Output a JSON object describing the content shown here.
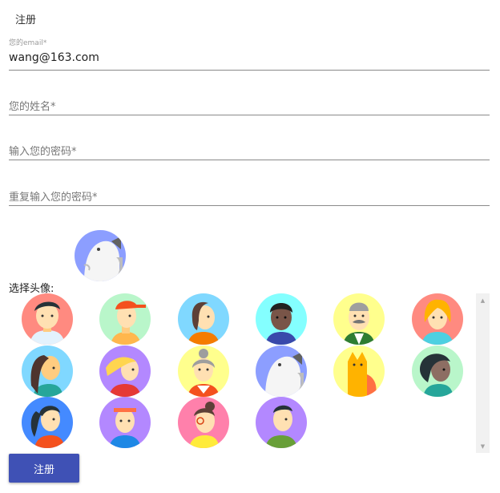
{
  "page": {
    "title": "注册"
  },
  "form": {
    "email": {
      "label": "您的email*",
      "value": "wang@163.com"
    },
    "name": {
      "placeholder": "您的姓名*"
    },
    "password": {
      "placeholder": "输入您的密码*"
    },
    "confirm_password": {
      "placeholder": "重复输入您的密码*"
    }
  },
  "selected_avatar": {
    "icon": "dog-avatar-icon",
    "bg": "#8c9eff"
  },
  "avatar_section": {
    "label": "选择头像:"
  },
  "avatars": [
    {
      "icon": "boy-dark-hair-avatar-icon",
      "bg": "#ff8a80"
    },
    {
      "icon": "boy-red-cap-avatar-icon",
      "bg": "#b9f6ca"
    },
    {
      "icon": "woman-brown-hair-avatar-icon",
      "bg": "#80d8ff"
    },
    {
      "icon": "dark-skin-man-avatar-icon",
      "bg": "#84ffff"
    },
    {
      "icon": "old-man-mustache-avatar-icon",
      "bg": "#ffff8d"
    },
    {
      "icon": "blonde-girl-avatar-icon",
      "bg": "#ff8a80"
    },
    {
      "icon": "long-hair-woman-avatar-icon",
      "bg": "#80d8ff"
    },
    {
      "icon": "blonde-woman-avatar-icon",
      "bg": "#b388ff"
    },
    {
      "icon": "grandma-avatar-icon",
      "bg": "#ffff8d"
    },
    {
      "icon": "dog-avatar-icon",
      "bg": "#8c9eff"
    },
    {
      "icon": "cat-avatar-icon",
      "bg": "#ffff8d"
    },
    {
      "icon": "dark-woman-avatar-icon",
      "bg": "#b9f6ca"
    },
    {
      "icon": "ponytail-girl-avatar-icon",
      "bg": "#448aff"
    },
    {
      "icon": "headband-man-avatar-icon",
      "bg": "#b388ff"
    },
    {
      "icon": "glasses-girl-avatar-icon",
      "bg": "#ff80ab"
    },
    {
      "icon": "green-shirt-man-avatar-icon",
      "bg": "#b388ff"
    }
  ],
  "scrollbar": {
    "up_arrow": "▲",
    "down_arrow": "▼"
  },
  "submit": {
    "label": "注册"
  }
}
